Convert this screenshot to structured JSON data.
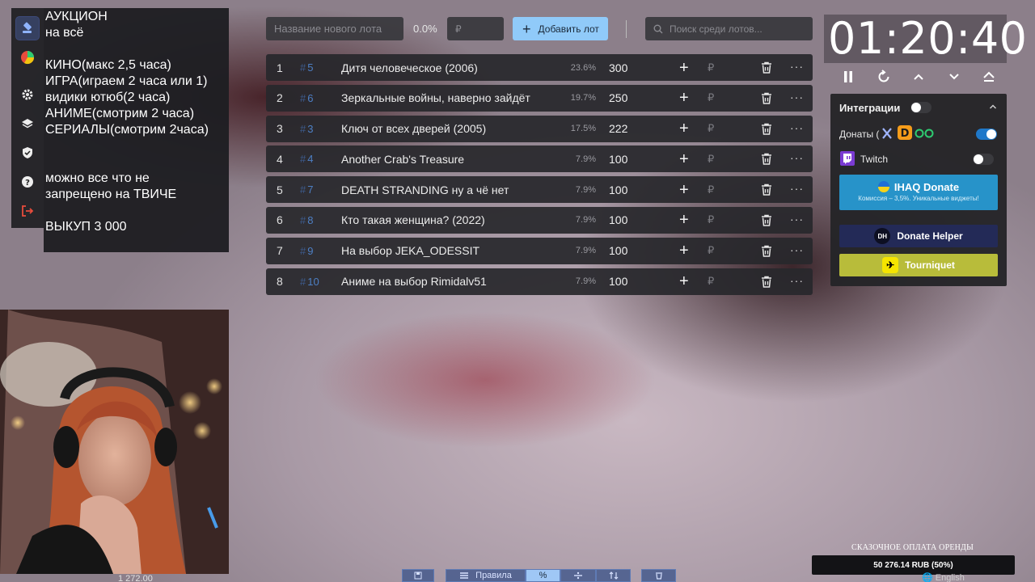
{
  "overlay_text": "АУКЦИОН\nна всё\n\nКИНО(макс 2,5 часа)\nИГРА(играем 2 часа или 1)\nвидики ютюб(2 часа)\nАНИМЕ(смотрим 2 часа)\nСЕРИАЛЫ(смотрим 2часа)\n\n\nможно все что не\nзапрещено на ТВИЧЕ\n\nВЫКУП 3 000",
  "toolbar": {
    "lot_name_placeholder": "Название нового лота",
    "percent": "0.0%",
    "currency_placeholder": "₽",
    "add_button_label": "Добавить лот",
    "search_placeholder": "Поиск среди лотов..."
  },
  "lots": [
    {
      "num": "1",
      "id": "5",
      "name": "Дитя человеческое (2006)",
      "percent": "23.6%",
      "amount": "300"
    },
    {
      "num": "2",
      "id": "6",
      "name": "Зеркальные войны, наверно зайдёт",
      "percent": "19.7%",
      "amount": "250"
    },
    {
      "num": "3",
      "id": "3",
      "name": "Ключ от всех дверей (2005)",
      "percent": "17.5%",
      "amount": "222"
    },
    {
      "num": "4",
      "id": "4",
      "name": "Another Crab's Treasure",
      "percent": "7.9%",
      "amount": "100"
    },
    {
      "num": "5",
      "id": "7",
      "name": "DEATH STRANDING ну а чё нет",
      "percent": "7.9%",
      "amount": "100"
    },
    {
      "num": "6",
      "id": "8",
      "name": "Кто такая женщина? (2022)",
      "percent": "7.9%",
      "amount": "100"
    },
    {
      "num": "7",
      "id": "9",
      "name": "На выбор JEKA_ODESSIT",
      "percent": "7.9%",
      "amount": "100"
    },
    {
      "num": "8",
      "id": "10",
      "name": "Аниме на выбор Rimidalv51",
      "percent": "7.9%",
      "amount": "100"
    }
  ],
  "lot_row": {
    "hash": "#",
    "add_symbol": "+",
    "currency": "₽",
    "more": "···"
  },
  "timer": {
    "value": "01:20:40"
  },
  "integrations": {
    "title": "Интеграции",
    "title_toggle_on": false,
    "donations_label": "Донаты (",
    "donations_toggle_on": true,
    "twitch_label": "Twitch",
    "twitch_toggle_on": false,
    "ihaq_label": "IHAQ Donate",
    "ihaq_subtitle": "Комиссия – 3,5%. Уникальные виджеты!",
    "donate_helper_label": "Donate Helper",
    "tourniquet_label": "Tourniquet"
  },
  "bottom": {
    "left_number": "1 272.00",
    "rules_label": "Правила",
    "percent_symbol": "%",
    "rent_title": "СКАЗОЧНОЕ ОПЛАТА ОРЕНДЫ",
    "rent_progress": "50 276.14 RUB (50%)",
    "rent_fraction": 0.5,
    "language": "English"
  },
  "colors": {
    "accent": "#90caf9",
    "ihaq": "#2793c9",
    "donate_helper": "#232a57",
    "tourniquet": "#b8bc3a",
    "lot_id": "#4d7fc4"
  }
}
